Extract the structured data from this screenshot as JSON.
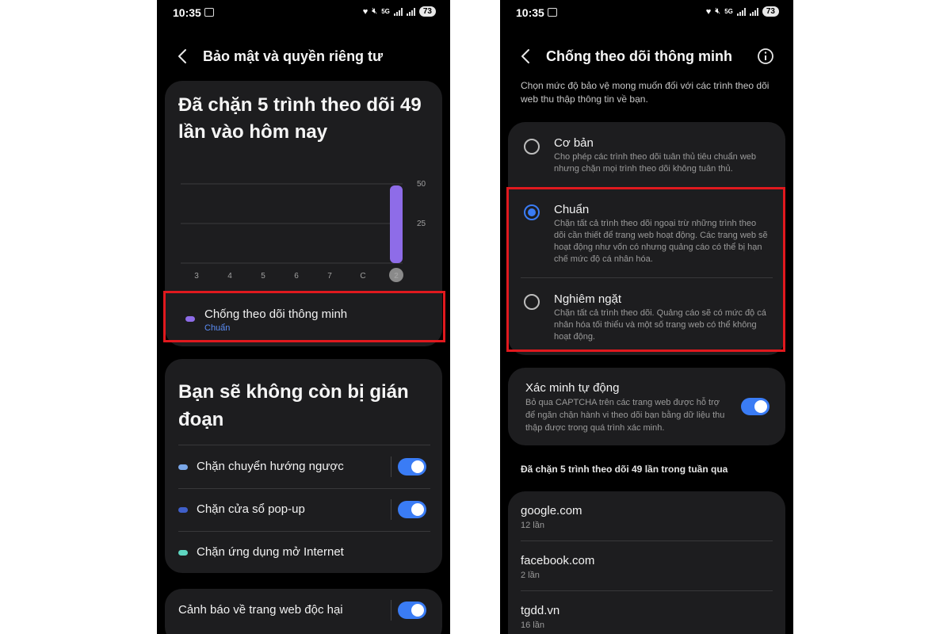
{
  "status_bar": {
    "time": "10:35",
    "network": "5G",
    "battery": "73"
  },
  "left_screen": {
    "header_title": "Bảo mật và quyền riêng tư",
    "stats_title": "Đã chặn 5 trình theo dõi 49 lần vào hôm nay",
    "chart_data": {
      "type": "bar",
      "categories": [
        "3",
        "4",
        "5",
        "6",
        "7",
        "C",
        "2"
      ],
      "values": [
        0,
        0,
        0,
        0,
        0,
        0,
        49
      ],
      "highlighted_category": "2",
      "y_ticks": [
        "50",
        "25"
      ],
      "ylim": [
        0,
        50
      ],
      "bar_color": "#8e6ce8",
      "grid": true
    },
    "legend": {
      "label": "Chống theo dõi thông minh",
      "sub": "Chuẩn",
      "dot_color": "#8e6ce8"
    },
    "interrupt_title": "Bạn sẽ không còn bị gián đoạn",
    "rows": [
      {
        "label": "Chặn chuyển hướng ngược",
        "dot_color": "#7aa7e8",
        "toggle": true
      },
      {
        "label": "Chặn cửa sổ pop-up",
        "dot_color": "#3f5fc9",
        "toggle": true
      },
      {
        "label": "Chặn ứng dụng mở Internet",
        "dot_color": "#5ed6c0",
        "toggle": false
      }
    ],
    "warning_label": "Cảnh báo về trang web độc hại"
  },
  "right_screen": {
    "header_title": "Chống theo dõi thông minh",
    "description": "Chọn mức độ bảo vệ mong muốn đối với các trình theo dõi web thu thập thông tin về bạn.",
    "options": [
      {
        "title": "Cơ bản",
        "desc": "Cho phép các trình theo dõi tuân thủ tiêu chuẩn web nhưng chặn mọi trình theo dõi không tuân thủ.",
        "selected": false
      },
      {
        "title": "Chuẩn",
        "desc": "Chặn tất cả trình theo dõi ngoại trừ những trình theo dõi cần thiết để trang web hoạt động. Các trang web sẽ hoạt động như vốn có nhưng quảng cáo có thể bị hạn chế mức độ cá nhân hóa.",
        "selected": true
      },
      {
        "title": "Nghiêm ngặt",
        "desc": "Chặn tất cả trình theo dõi. Quảng cáo sẽ có mức độ cá nhân hóa tối thiểu và một số trang web có thể không hoạt động.",
        "selected": false
      }
    ],
    "verify": {
      "title": "Xác minh tự động",
      "desc": "Bỏ qua CAPTCHA trên các trang web được hỗ trợ để ngăn chặn hành vi theo dõi bạn bằng dữ liệu thu thập được trong quá trình xác minh.",
      "toggle": true
    },
    "section_title": "Đã chặn 5 trình theo dõi 49 lần trong tuần qua",
    "sites": [
      {
        "name": "google.com",
        "count": "12 lần"
      },
      {
        "name": "facebook.com",
        "count": "2 lần"
      },
      {
        "name": "tgdd.vn",
        "count": "16 lần"
      }
    ]
  },
  "colors": {
    "accent": "#3a7cf5",
    "highlight_box": "#e0191e",
    "card": "#1d1d1f",
    "background": "#000000"
  }
}
